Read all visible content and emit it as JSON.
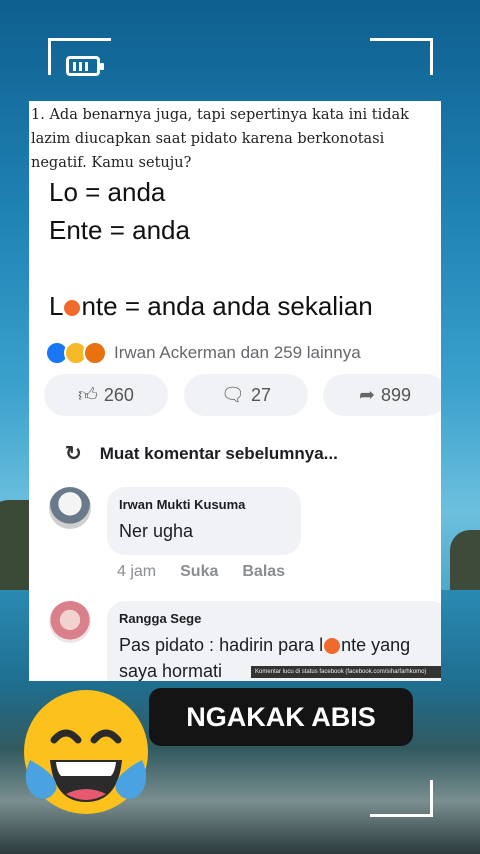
{
  "question": "1. Ada benarnya juga, tapi sepertinya kata ini tidak lazim diucapkan saat pidato karena berkonotasi negatif. Kamu setuju?",
  "lines": {
    "line1": "Lo = anda",
    "line2": "Ente = anda",
    "line3_prefix": "L",
    "line3_suffix": "nte = anda anda sekalian"
  },
  "reactions": {
    "icons": [
      "like-icon",
      "haha-icon",
      "angry-icon"
    ],
    "summary": "Irwan Ackerman dan 259 lainnya"
  },
  "actions": {
    "likes": "260",
    "comments": "27",
    "shares": "899"
  },
  "load_more": "Muat komentar sebelumnya...",
  "comments": [
    {
      "name": "Irwan Mukti Kusuma",
      "text": "Ner ugha",
      "time": "4 jam",
      "like_label": "Suka",
      "reply_label": "Balas"
    },
    {
      "name": "Rangga Sege",
      "text_prefix": "Pas pidato : hadirin para l",
      "text_suffix": "nte yang saya hormati"
    }
  ],
  "watermark": "Komentar lucu di status facebook (facebook.com/siharfarhkomo)",
  "banner": "NGAKAK ABIS",
  "colors": {
    "accent_blue": "#1877f2",
    "blot": "#ef6a2c",
    "banner_bg": "#141414"
  }
}
